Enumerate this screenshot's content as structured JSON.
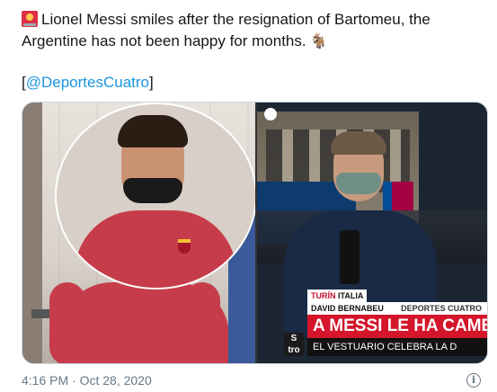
{
  "tweet": {
    "text": "Lionel Messi smiles after the resignation of Bartomeu, the Argentine has not been happy for months.",
    "lead_emoji": "rotating-light-icon",
    "trail_emoji": "goat-icon",
    "mention_open": "[",
    "mention": "@DeportesCuatro",
    "mention_close": "]",
    "timestamp": "4:16 PM · Oct 28, 2020"
  },
  "broadcast": {
    "location_city": "TURÍN",
    "location_country": "ITALIA",
    "reporter_name": "DAVID BERNABEU",
    "channel_label": "DEPORTES CUATRO",
    "headline": "A MESSI LE HA CAMB",
    "subheadline": "EL VESTUARIO CELEBRA LA D",
    "logo_text": "S",
    "logo_text2": "tro"
  },
  "colors": {
    "link": "#1b95e0",
    "headline_red": "#d4152a"
  }
}
